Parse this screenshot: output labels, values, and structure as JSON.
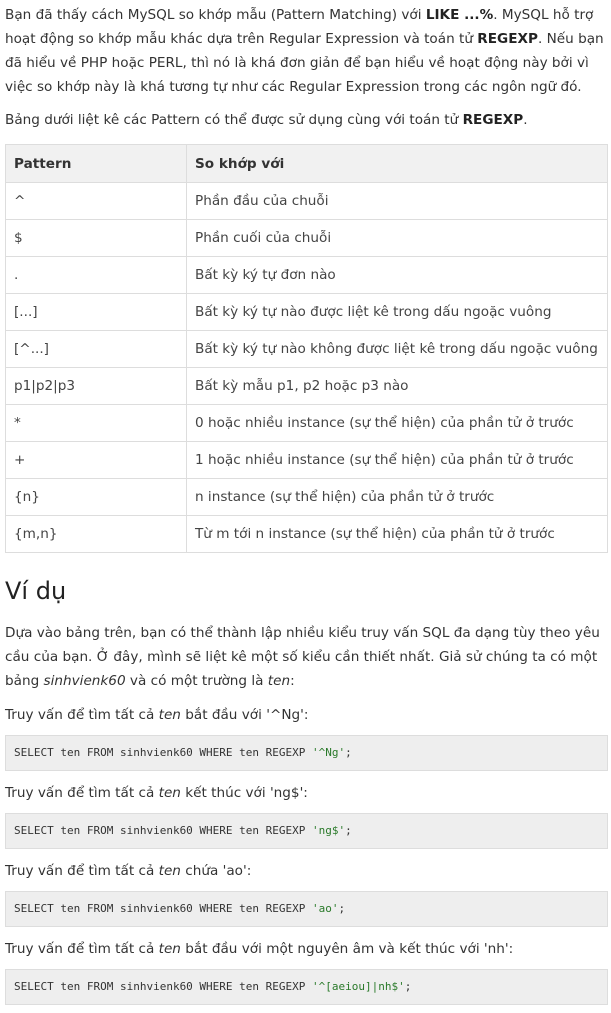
{
  "intro": {
    "t1": "Bạn đã thấy cách MySQL so khớp mẫu (Pattern Matching) với ",
    "b1": "LIKE ...%",
    "t2": ". MySQL hỗ trợ hoạt động so khớp mẫu khác dựa trên Regular Expression và toán tử ",
    "b2": "REGEXP",
    "t3": ". Nếu bạn đã hiểu về PHP hoặc PERL, thì nó là khá đơn giản để bạn hiểu về hoạt động này bởi vì việc so khớp này là khá tương tự như các Regular Expression trong các ngôn ngữ đó."
  },
  "table_caption": {
    "t1": "Bảng dưới liệt kê các Pattern có thể được sử dụng cùng với toán tử ",
    "b1": "REGEXP",
    "t2": "."
  },
  "table": {
    "headers": [
      "Pattern",
      "So khớp với"
    ],
    "rows": [
      [
        "^",
        "Phần đầu của chuỗi"
      ],
      [
        "$",
        "Phần cuối của chuỗi"
      ],
      [
        ".",
        "Bất kỳ ký tự đơn nào"
      ],
      [
        "[...]",
        "Bất kỳ ký tự nào được liệt kê trong dấu ngoặc vuông"
      ],
      [
        "[^...]",
        "Bất kỳ ký tự nào không được liệt kê trong dấu ngoặc vuông"
      ],
      [
        "p1|p2|p3",
        "Bất kỳ mẫu p1, p2 hoặc p3 nào"
      ],
      [
        "*",
        "0 hoặc nhiều instance (sự thể hiện) của phần tử ở trước"
      ],
      [
        "+",
        "1 hoặc nhiều instance (sự thể hiện) của phần tử ở trước"
      ],
      [
        "{n}",
        "n instance (sự thể hiện) của phần tử ở trước"
      ],
      [
        "{m,n}",
        "Từ m tới n instance (sự thể hiện) của phần tử ở trước"
      ]
    ]
  },
  "example": {
    "heading": "Ví dụ",
    "p_t1": "Dựa vào bảng trên, bạn có thể thành lập nhiều kiểu truy vấn SQL đa dạng tùy theo yêu cầu của bạn. Ở đây, mình sẽ liệt kê một số kiểu cần thiết nhất. Giả sử chúng ta có một bảng ",
    "p_em1": "sinhvienk60",
    "p_t2": " và có một trường là ",
    "p_em2": "ten",
    "p_t3": ":",
    "queries": [
      {
        "pre": "Truy vấn để tìm tất cả ",
        "em": "ten",
        "post": " bắt đầu với '^Ng':",
        "code": "SELECT ten FROM sinhvienk60 WHERE ten REGEXP ",
        "str": "'^Ng'",
        "end": ";"
      },
      {
        "pre": "Truy vấn để tìm tất cả ",
        "em": "ten",
        "post": " kết thúc với 'ng$':",
        "code": "SELECT ten FROM sinhvienk60 WHERE ten REGEXP ",
        "str": "'ng$'",
        "end": ";"
      },
      {
        "pre": "Truy vấn để tìm tất cả ",
        "em": "ten",
        "post": " chứa 'ao':",
        "code": "SELECT ten FROM sinhvienk60 WHERE ten REGEXP ",
        "str": "'ao'",
        "end": ";"
      },
      {
        "pre": "Truy vấn để tìm tất cả ",
        "em": "ten",
        "post": " bắt đầu với một nguyên âm và kết thúc với 'nh':",
        "code": "SELECT ten FROM sinhvienk60 WHERE ten REGEXP ",
        "str": "'^[aeiou]|nh$'",
        "end": ";"
      }
    ]
  }
}
